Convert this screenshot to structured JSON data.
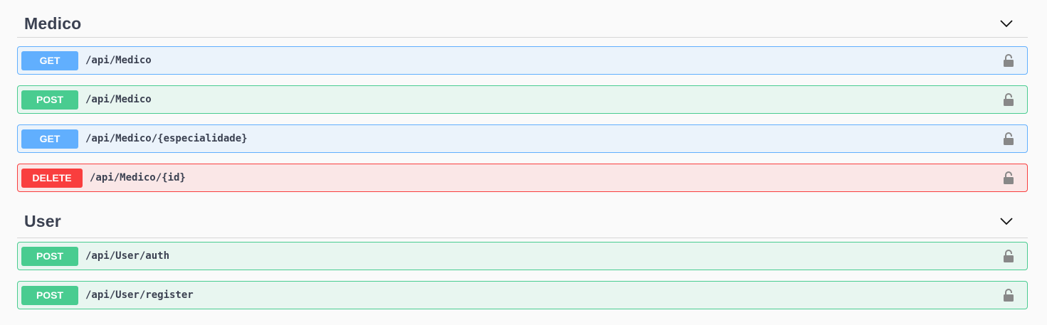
{
  "sections": [
    {
      "title": "Medico",
      "operations": [
        {
          "method": "GET",
          "path": "/api/Medico"
        },
        {
          "method": "POST",
          "path": "/api/Medico"
        },
        {
          "method": "GET",
          "path": "/api/Medico/{especialidade}"
        },
        {
          "method": "DELETE",
          "path": "/api/Medico/{id}"
        }
      ]
    },
    {
      "title": "User",
      "operations": [
        {
          "method": "POST",
          "path": "/api/User/auth"
        },
        {
          "method": "POST",
          "path": "/api/User/register"
        }
      ]
    }
  ],
  "colors": {
    "get": "#61affe",
    "post": "#49cc90",
    "delete": "#f93e3e"
  },
  "icons": {
    "expand": "chevron-down-icon",
    "auth": "lock-icon"
  }
}
